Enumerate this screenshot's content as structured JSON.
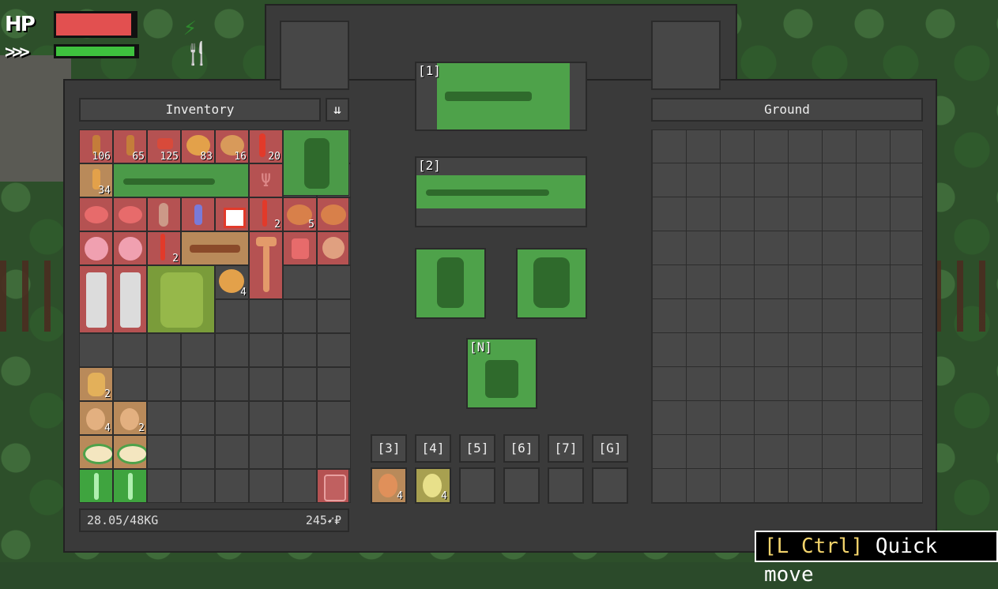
{
  "hud": {
    "hp_label": "HP",
    "hp_fraction": 0.95,
    "stamina_label": ">>>",
    "stamina_fraction": 0.97,
    "status_icons": [
      "lightning-icon",
      "fork-knife-icon"
    ]
  },
  "inventory": {
    "title": "Inventory",
    "sort_icon": "sort-icon",
    "weight": "28.05/48KG",
    "money": "245",
    "currency_symbol": "₽",
    "items": [
      {
        "name": "item-bottle-1",
        "count": "106"
      },
      {
        "name": "item-bottle-2",
        "count": "65"
      },
      {
        "name": "item-can",
        "count": "125"
      },
      {
        "name": "item-pellets-1",
        "count": "83"
      },
      {
        "name": "item-pellets-2",
        "count": "16"
      },
      {
        "name": "item-shells",
        "count": "20"
      },
      {
        "name": "item-bottle-3",
        "count": "34"
      },
      {
        "name": "item-red-vial",
        "count": "2"
      },
      {
        "name": "item-meat-big",
        "count": "5"
      },
      {
        "name": "item-red-stick",
        "count": "2"
      },
      {
        "name": "item-nuggets",
        "count": "4"
      },
      {
        "name": "item-sack",
        "count": "2"
      },
      {
        "name": "item-potato-1",
        "count": "4"
      },
      {
        "name": "item-potato-2",
        "count": "2"
      }
    ]
  },
  "equipment": {
    "slot1_label": "[1]",
    "slot2_label": "[2]",
    "slotN_label": "[N]",
    "quick_labels": [
      "[3]",
      "[4]",
      "[5]",
      "[6]",
      "[7]",
      "[G]"
    ],
    "quick_counts": [
      "4",
      "4"
    ]
  },
  "ground": {
    "title": "Ground"
  },
  "hint": {
    "key": "[L Ctrl]",
    "action": " Quick move"
  },
  "colors": {
    "hp": "#e25050",
    "stamina": "#3ec23e",
    "equipped": "#4ea24a",
    "item_red": "#b55252"
  }
}
